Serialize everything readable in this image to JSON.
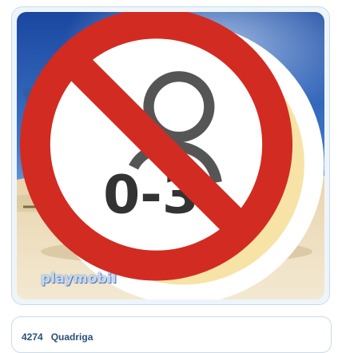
{
  "product": {
    "number": "4274",
    "name": "Quadriga"
  },
  "brand": {
    "logo_text": "playmobil"
  },
  "age_warning": {
    "label": "0-3"
  },
  "icons": {
    "emblem": "helmet-emblem-icon",
    "age_warning": "no-under-3-icon"
  },
  "colors": {
    "sky_top": "#1b4fa8",
    "sky_mid": "#4f86d1",
    "sand": "#e9d6ad",
    "frame_border": "#c9dbe8",
    "caption_text": "#2a4f7a"
  }
}
